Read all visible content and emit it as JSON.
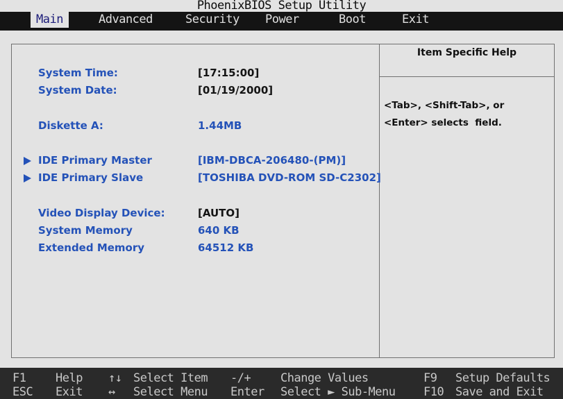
{
  "window": {
    "title": "PhoenixBIOS Setup Utility"
  },
  "menu": {
    "items": [
      "Main",
      "Advanced",
      "Security",
      "Power",
      "Boot",
      "Exit"
    ],
    "active": "Main"
  },
  "main": {
    "system_time": {
      "label": "System Time:",
      "value": "[17:15:00]"
    },
    "system_date": {
      "label": "System Date:",
      "value": "[01/19/2000]"
    },
    "diskette_a": {
      "label": "Diskette A:",
      "value": "1.44MB"
    },
    "ide_primary_master": {
      "label": "IDE Primary Master",
      "value": "[IBM-DBCA-206480-(PM)]"
    },
    "ide_primary_slave": {
      "label": "IDE Primary Slave",
      "value": "[TOSHIBA DVD-ROM SD-C2302]"
    },
    "video_display_device": {
      "label": "Video Display Device:",
      "value": "[AUTO]"
    },
    "system_memory": {
      "label": "System Memory",
      "value": "640 KB"
    },
    "extended_memory": {
      "label": "Extended Memory",
      "value": "64512 KB"
    }
  },
  "help": {
    "title": "Item Specific Help",
    "line1": "<Tab>, <Shift-Tab>, or",
    "line2": "<Enter> selects  field."
  },
  "status_bar": {
    "row1": {
      "key1": "F1",
      "desc1": "Help",
      "key2": "↑↓",
      "desc2": "Select Item",
      "key3": "-/+",
      "desc3": "Change Values",
      "key4": "F9",
      "desc4": "Setup Defaults"
    },
    "row2": {
      "key1": "ESC",
      "desc1": "Exit",
      "key2": "↔",
      "desc2": "Select Menu",
      "key3": "Enter",
      "desc3": "Select ► Sub-Menu",
      "key4": "F10",
      "desc4": "Save and Exit"
    }
  },
  "colors": {
    "background": "#e3e3e3",
    "menu_bar": "#141414",
    "field_blue": "#2452b8",
    "status_bar": "#2a2a2a"
  }
}
